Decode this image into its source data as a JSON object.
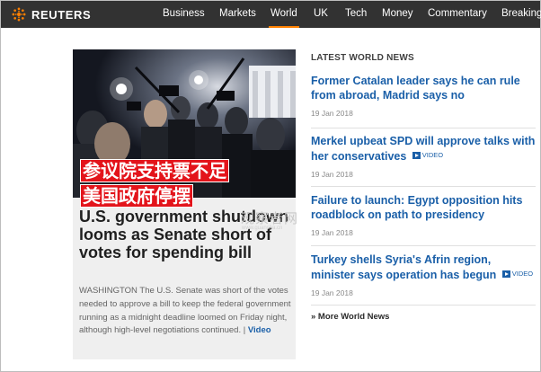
{
  "brand": {
    "name": "REUTERS"
  },
  "nav": {
    "items": [
      {
        "label": "Business"
      },
      {
        "label": "Markets"
      },
      {
        "label": "World",
        "active": true
      },
      {
        "label": "UK"
      },
      {
        "label": "Tech"
      },
      {
        "label": "Money"
      },
      {
        "label": "Commentary"
      },
      {
        "label": "Breakingviews"
      }
    ]
  },
  "feature": {
    "overlay_line1": "参议院支持票不足",
    "overlay_line2": "美国政府停摆",
    "headline": "U.S. government shutdown looms as Senate short of votes for spending bill",
    "summary": "WASHINGTON The U.S. Senate was short of the votes needed to approve a bill to keep the federal government running as a midnight deadline loomed on Friday night, although high-level negotiations continued.",
    "separator": "|",
    "video_label": "Video"
  },
  "watermark": {
    "text": "观察者网",
    "sub": "www.guancha.cn"
  },
  "latest": {
    "title": "LATEST WORLD NEWS",
    "video_tag": "VIDEO",
    "stories": [
      {
        "title": "Former Catalan leader says he can rule from abroad, Madrid says no",
        "date": "19 Jan 2018",
        "video": false
      },
      {
        "title": "Merkel upbeat SPD will approve talks with her conservatives",
        "date": "19 Jan 2018",
        "video": true
      },
      {
        "title": "Failure to launch: Egypt opposition hits roadblock on path to presidency",
        "date": "19 Jan 2018",
        "video": false
      },
      {
        "title": "Turkey shells Syria's Afrin region, minister says operation has begun",
        "date": "19 Jan 2018",
        "video": true
      }
    ],
    "more_label": "» More World News"
  },
  "colors": {
    "nav_bg": "#323232",
    "active_underline": "#ff8000",
    "link_blue": "#1a5fa8",
    "overlay_red": "#e3141b",
    "brand_orange": "#ff8000"
  }
}
